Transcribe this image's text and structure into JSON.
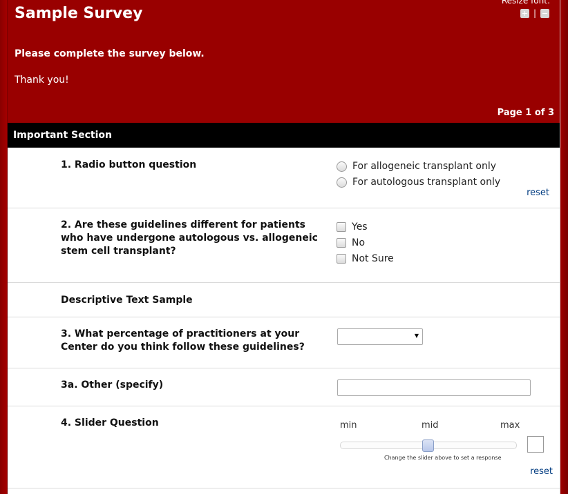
{
  "header": {
    "title": "Sample Survey",
    "resize_font_label": "Resize font:",
    "resize_separator": "|",
    "intro": "Please complete the survey below.",
    "thanks": "Thank you!",
    "page_indicator": "Page 1 of 3"
  },
  "section": {
    "title": "Important Section"
  },
  "questions": {
    "q1": {
      "label": "1. Radio button question",
      "options": [
        "For allogeneic transplant only",
        "For autologous transplant only"
      ],
      "reset": "reset"
    },
    "q2": {
      "label": "2. Are these guidelines different for patients who have undergone autologous vs. allogeneic stem cell transplant?",
      "options": [
        "Yes",
        "No",
        "Not Sure"
      ]
    },
    "descriptive": {
      "text": "Descriptive Text Sample"
    },
    "q3": {
      "label": "3. What percentage of practitioners at your Center do you think follow these guidelines?",
      "selected": ""
    },
    "q3a": {
      "label": "3a. Other (specify)",
      "value": ""
    },
    "q4": {
      "label": "4. Slider Question",
      "min_label": "min",
      "mid_label": "mid",
      "max_label": "max",
      "value_fraction": 0.5,
      "hint": "Change the slider above to set a response",
      "reset": "reset",
      "value": ""
    }
  }
}
